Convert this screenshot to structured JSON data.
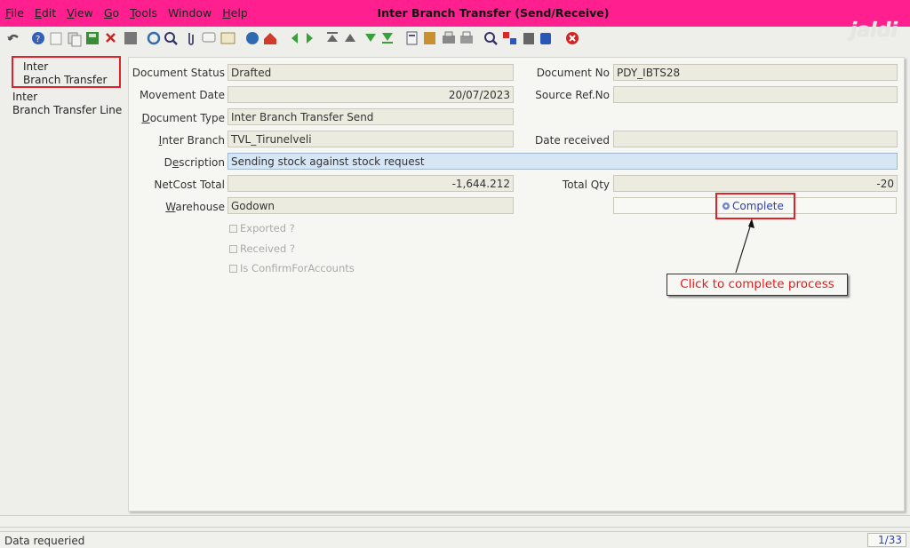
{
  "window": {
    "title": "Inter Branch Transfer (Send/Receive)"
  },
  "menu": [
    {
      "mnemonic": "F",
      "rest": "ile"
    },
    {
      "mnemonic": "E",
      "rest": "dit"
    },
    {
      "mnemonic": "V",
      "rest": "iew"
    },
    {
      "mnemonic": "G",
      "rest": "o"
    },
    {
      "mnemonic": "T",
      "rest": "ools"
    },
    {
      "mnemonic": "W",
      "rest": "indow"
    },
    {
      "mnemonic": "H",
      "rest": "elp"
    }
  ],
  "branding": {
    "logo_text": "jaldi"
  },
  "tree": {
    "item1": {
      "line1": "Inter",
      "line2": "Branch Transfer"
    },
    "item2": {
      "line1": "Inter",
      "line2": "Branch Transfer Line"
    }
  },
  "form": {
    "document_status": {
      "label": "Document Status",
      "value": "Drafted"
    },
    "document_no": {
      "label": "Document No",
      "value": "PDY_IBTS28"
    },
    "movement_date": {
      "label": "Movement Date",
      "value": "20/07/2023"
    },
    "source_ref": {
      "label": "Source Ref.No",
      "value": ""
    },
    "document_type": {
      "label_mn": "D",
      "label_rest": "ocument Type",
      "value": "Inter Branch Transfer Send"
    },
    "inter_branch": {
      "label_mn": "I",
      "label_rest": "nter Branch",
      "value": "TVL_Tirunelveli"
    },
    "date_received": {
      "label": "Date received",
      "value": ""
    },
    "description": {
      "label_pre": "D",
      "label_mn": "e",
      "label_rest": "scription",
      "value": "Sending stock against stock request"
    },
    "netcost_total": {
      "label": "NetCost Total",
      "value": "-1,644.212"
    },
    "total_qty": {
      "label": "Total Qty",
      "value": "-20"
    },
    "warehouse": {
      "label_mn": "W",
      "label_rest": "arehouse",
      "value": "Godown"
    },
    "exported": {
      "label": "Exported ?",
      "checked": false
    },
    "received": {
      "label": "Received ?",
      "checked": false
    },
    "confirm_accounts": {
      "label": "Is ConfirmForAccounts",
      "checked": false
    }
  },
  "actions": {
    "complete_label": "Complete"
  },
  "annotation": {
    "callout_text": "Click to complete process"
  },
  "status": {
    "message": "Data requeried",
    "page": "1/33"
  },
  "colors": {
    "titlebar": "#ff1f8f",
    "highlight_box": "#e0232a",
    "callout_text": "#e21c1c",
    "link_blue": "#2a3fbd"
  }
}
